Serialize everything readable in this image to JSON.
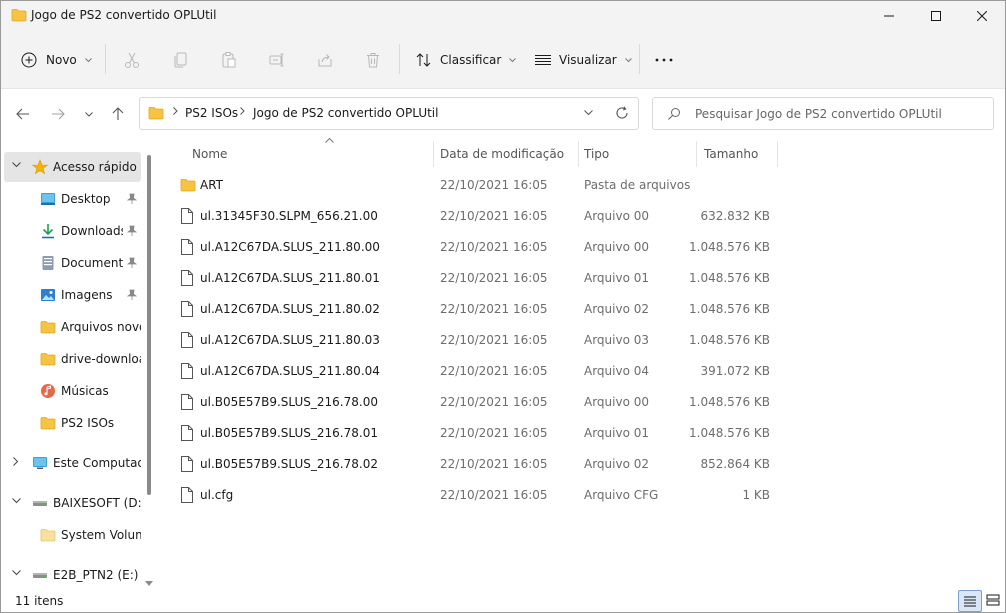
{
  "window": {
    "title": "Jogo de PS2 convertido OPLUtil"
  },
  "toolbar": {
    "new_label": "Novo",
    "sort_label": "Classificar",
    "view_label": "Visualizar"
  },
  "address": {
    "crumbs": [
      "PS2 ISOs",
      "Jogo de PS2 convertido OPLUtil"
    ]
  },
  "search": {
    "placeholder": "Pesquisar Jogo de PS2 convertido OPLUtil"
  },
  "sidebar": {
    "items": [
      {
        "label": "Acesso rápido",
        "icon": "star-icon"
      },
      {
        "label": "Desktop",
        "icon": "desktop-icon"
      },
      {
        "label": "Downloads",
        "icon": "download-icon"
      },
      {
        "label": "Documentos",
        "icon": "document-icon"
      },
      {
        "label": "Imagens",
        "icon": "image-icon"
      },
      {
        "label": "Arquivos novos",
        "icon": "folder-icon"
      },
      {
        "label": "drive-download",
        "icon": "folder-icon"
      },
      {
        "label": "Músicas",
        "icon": "music-icon"
      },
      {
        "label": "PS2 ISOs",
        "icon": "folder-icon"
      },
      {
        "label": "Este Computador",
        "icon": "computer-icon"
      },
      {
        "label": "BAIXESOFT (D:)",
        "icon": "drive-icon"
      },
      {
        "label": "System Volume",
        "icon": "folder-icon"
      },
      {
        "label": "E2B_PTN2 (E:)",
        "icon": "drive-icon"
      }
    ]
  },
  "filelist": {
    "columns": {
      "name": "Nome",
      "date": "Data de modificação",
      "type": "Tipo",
      "size": "Tamanho"
    },
    "rows": [
      {
        "name": "ART",
        "date": "22/10/2021 16:05",
        "type": "Pasta de arquivos",
        "size": "",
        "kind": "folder"
      },
      {
        "name": "ul.31345F30.SLPM_656.21.00",
        "date": "22/10/2021 16:05",
        "type": "Arquivo 00",
        "size": "632.832 KB",
        "kind": "file"
      },
      {
        "name": "ul.A12C67DA.SLUS_211.80.00",
        "date": "22/10/2021 16:05",
        "type": "Arquivo 00",
        "size": "1.048.576 KB",
        "kind": "file"
      },
      {
        "name": "ul.A12C67DA.SLUS_211.80.01",
        "date": "22/10/2021 16:05",
        "type": "Arquivo 01",
        "size": "1.048.576 KB",
        "kind": "file"
      },
      {
        "name": "ul.A12C67DA.SLUS_211.80.02",
        "date": "22/10/2021 16:05",
        "type": "Arquivo 02",
        "size": "1.048.576 KB",
        "kind": "file"
      },
      {
        "name": "ul.A12C67DA.SLUS_211.80.03",
        "date": "22/10/2021 16:05",
        "type": "Arquivo 03",
        "size": "1.048.576 KB",
        "kind": "file"
      },
      {
        "name": "ul.A12C67DA.SLUS_211.80.04",
        "date": "22/10/2021 16:05",
        "type": "Arquivo 04",
        "size": "391.072 KB",
        "kind": "file"
      },
      {
        "name": "ul.B05E57B9.SLUS_216.78.00",
        "date": "22/10/2021 16:05",
        "type": "Arquivo 00",
        "size": "1.048.576 KB",
        "kind": "file"
      },
      {
        "name": "ul.B05E57B9.SLUS_216.78.01",
        "date": "22/10/2021 16:05",
        "type": "Arquivo 01",
        "size": "1.048.576 KB",
        "kind": "file"
      },
      {
        "name": "ul.B05E57B9.SLUS_216.78.02",
        "date": "22/10/2021 16:05",
        "type": "Arquivo 02",
        "size": "852.864 KB",
        "kind": "file"
      },
      {
        "name": "ul.cfg",
        "date": "22/10/2021 16:05",
        "type": "Arquivo CFG",
        "size": "1 KB",
        "kind": "file"
      }
    ]
  },
  "status": {
    "count": "11 itens"
  },
  "colors": {
    "folder": "#f6c342",
    "folder_dark": "#e2a820",
    "accent": "#0067c0",
    "selected": "#e5e5e5"
  }
}
